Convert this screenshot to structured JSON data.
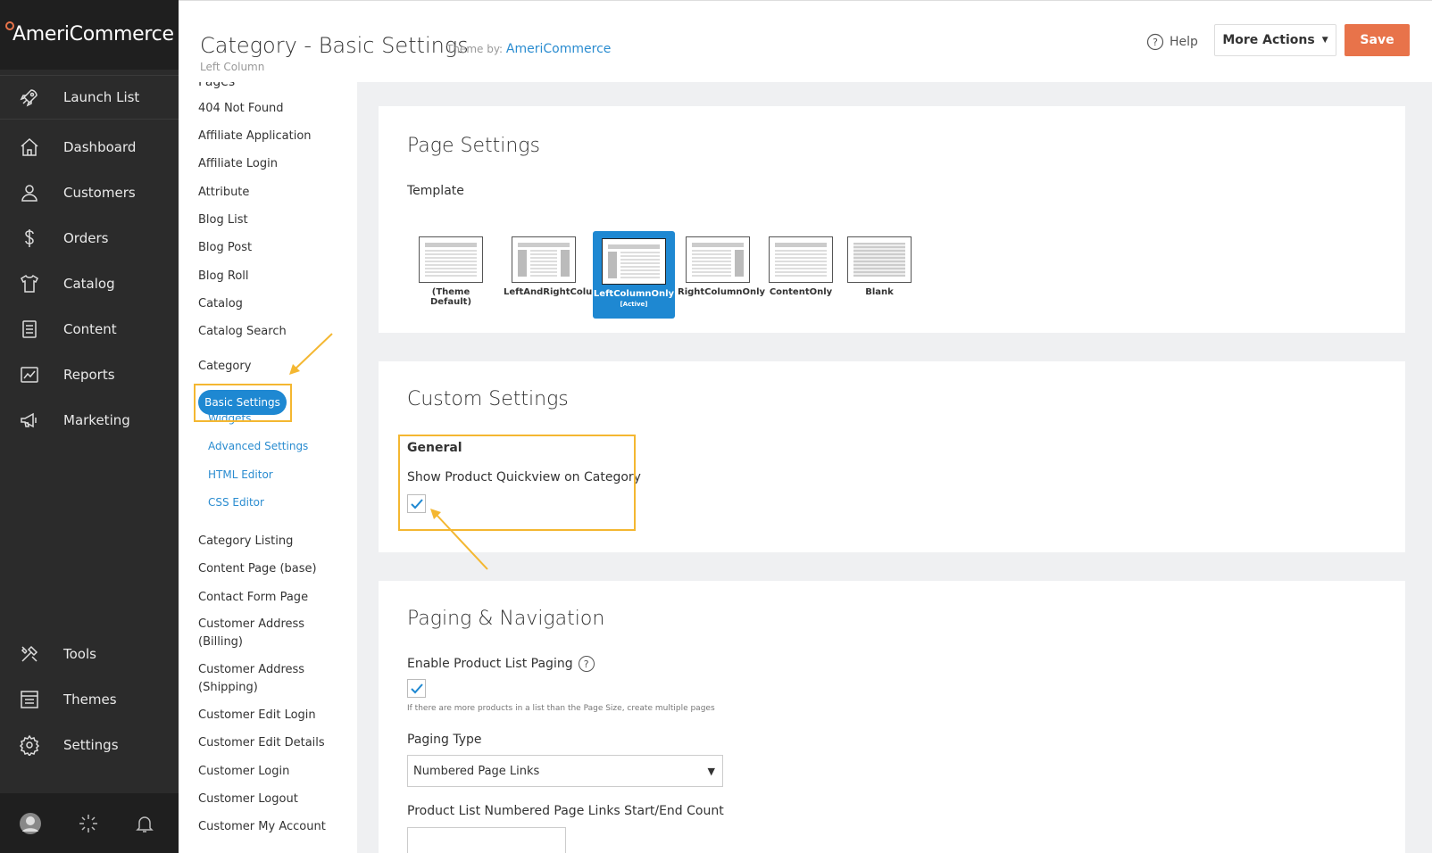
{
  "brand": {
    "name": "AmeriCommerce"
  },
  "nav": {
    "launch": "Launch List",
    "items": [
      {
        "label": "Dashboard",
        "icon": "home-icon"
      },
      {
        "label": "Customers",
        "icon": "user-icon"
      },
      {
        "label": "Orders",
        "icon": "dollar-icon"
      },
      {
        "label": "Catalog",
        "icon": "shirt-icon"
      },
      {
        "label": "Content",
        "icon": "document-icon"
      },
      {
        "label": "Reports",
        "icon": "chart-icon"
      },
      {
        "label": "Marketing",
        "icon": "megaphone-icon"
      }
    ],
    "lower": [
      {
        "label": "Tools",
        "icon": "tools-icon"
      },
      {
        "label": "Themes",
        "icon": "layout-icon"
      },
      {
        "label": "Settings",
        "icon": "gear-icon"
      }
    ]
  },
  "header": {
    "title": "Category - Basic Settings",
    "theme_prefix": "Theme by:",
    "theme_name": "AmeriCommerce",
    "subtitle": "Left Column",
    "help": "Help",
    "more_actions": "More Actions",
    "save": "Save"
  },
  "pages": {
    "heading": "Pages",
    "before": [
      "404 Not Found",
      "Affiliate Application",
      "Affiliate Login",
      "Attribute",
      "Blog List",
      "Blog Post",
      "Blog Roll",
      "Catalog",
      "Catalog Search"
    ],
    "category": "Category",
    "category_subs": [
      "Basic Settings",
      "Widgets",
      "Advanced Settings",
      "HTML Editor",
      "CSS Editor"
    ],
    "after": [
      "Category Listing",
      "Content Page (base)",
      "Contact Form Page",
      "Customer Address (Billing)",
      "Customer Address (Shipping)",
      "Customer Edit Login",
      "Customer Edit Details",
      "Customer Login",
      "Customer Logout",
      "Customer My Account"
    ]
  },
  "page_settings": {
    "title": "Page Settings",
    "template_label": "Template",
    "templates": [
      {
        "name": "(Theme Default)",
        "layout": "default"
      },
      {
        "name": "LeftAndRightColumns",
        "layout": "both"
      },
      {
        "name": "LeftColumnOnly",
        "layout": "left",
        "active_label": "[Active]"
      },
      {
        "name": "RightColumnOnly",
        "layout": "right"
      },
      {
        "name": "ContentOnly",
        "layout": "content"
      },
      {
        "name": "Blank",
        "layout": "blank"
      }
    ],
    "active_template": "LeftColumnOnly"
  },
  "custom_settings": {
    "title": "Custom Settings",
    "group": "General",
    "option_label": "Show Product Quickview on Category",
    "option_checked": true
  },
  "paging": {
    "title": "Paging & Navigation",
    "enable_label": "Enable Product List Paging",
    "enable_checked": true,
    "enable_hint": "If there are more products in a list than the Page Size, create multiple pages",
    "type_label": "Paging Type",
    "type_value": "Numbered Page Links",
    "count_label": "Product List Numbered Page Links Start/End Count"
  },
  "colors": {
    "accent": "#1e88d2",
    "save": "#e8734a",
    "highlight": "#f4b731",
    "nav_bg": "#2b2b2b"
  }
}
